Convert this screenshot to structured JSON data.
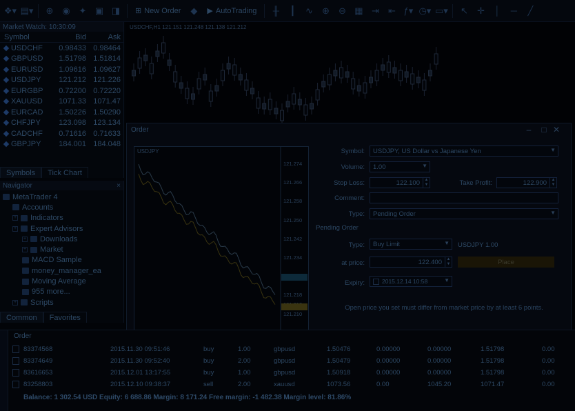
{
  "toolbar": {
    "new_order_label": "New Order",
    "autotrading_label": "AutoTrading"
  },
  "market_watch": {
    "title": "Market Watch: 10:30:09",
    "col_symbol": "Symbol",
    "col_bid": "Bid",
    "col_ask": "Ask",
    "rows": [
      {
        "symbol": "USDCHF",
        "bid": "0.98433",
        "ask": "0.98464"
      },
      {
        "symbol": "GBPUSD",
        "bid": "1.51798",
        "ask": "1.51814"
      },
      {
        "symbol": "EURUSD",
        "bid": "1.09616",
        "ask": "1.09627"
      },
      {
        "symbol": "USDJPY",
        "bid": "121.212",
        "ask": "121.226"
      },
      {
        "symbol": "EURGBP",
        "bid": "0.72200",
        "ask": "0.72220"
      },
      {
        "symbol": "XAUUSD",
        "bid": "1071.33",
        "ask": "1071.47"
      },
      {
        "symbol": "EURCAD",
        "bid": "1.50226",
        "ask": "1.50290"
      },
      {
        "symbol": "CHFJPY",
        "bid": "123.098",
        "ask": "123.134"
      },
      {
        "symbol": "CADCHF",
        "bid": "0.71616",
        "ask": "0.71633"
      },
      {
        "symbol": "GBPJPY",
        "bid": "184.001",
        "ask": "184.048"
      }
    ],
    "tabs": [
      "Symbols",
      "Tick Chart"
    ]
  },
  "navigator": {
    "title": "Navigator",
    "items": [
      {
        "label": "MetaTrader 4",
        "level": 0
      },
      {
        "label": "Accounts",
        "level": 1
      },
      {
        "label": "Indicators",
        "level": 1
      },
      {
        "label": "Expert Advisors",
        "level": 1
      },
      {
        "label": "Downloads",
        "level": 2
      },
      {
        "label": "Market",
        "level": 2
      },
      {
        "label": "MACD Sample",
        "level": 2
      },
      {
        "label": "money_manager_ea",
        "level": 2
      },
      {
        "label": "Moving Average",
        "level": 2
      },
      {
        "label": "955 more...",
        "level": 2
      },
      {
        "label": "Scripts",
        "level": 1
      }
    ],
    "tabs": [
      "Common",
      "Favorites"
    ]
  },
  "chart": {
    "header": "USDCHF,H1  121.151 121.248 121.138 121.212"
  },
  "order_dialog": {
    "title": "Order",
    "mini_chart_symbol": "USDJPY",
    "mini_chart_ticks": [
      "121.274",
      "121.266",
      "121.258",
      "121.250",
      "121.242",
      "121.234",
      "121.226",
      "121.218",
      "121.212",
      "121.210",
      "121.202"
    ],
    "symbol_label": "Symbol:",
    "symbol_value": "USDJPY, US Dollar vs Japanese Yen",
    "volume_label": "Volume:",
    "volume_value": "1.00",
    "stop_loss_label": "Stop Loss:",
    "stop_loss_value": "122.100",
    "take_profit_label": "Take Profit:",
    "take_profit_value": "122.900",
    "comment_label": "Comment:",
    "comment_value": "",
    "type_label": "Type:",
    "type_value": "Pending Order",
    "pending_section": "Pending Order",
    "pending_type_label": "Type:",
    "pending_type_value": "Buy Limit",
    "pending_info": "USDJPY 1.00",
    "price_label": "at price:",
    "price_value": "122.400",
    "place_label": "Place",
    "expiry_label": "Expiry:",
    "expiry_value": "2015.12.14 10:58",
    "notice": "Open price you set must differ from market price by at least 6 points."
  },
  "terminal": {
    "header": "Order",
    "rows": [
      {
        "order": "83374568",
        "time": "2015.11.30 09:51:46",
        "type": "buy",
        "size": "1.00",
        "symbol": "gbpusd",
        "price": "1.50476",
        "sl": "0.00000",
        "tp": "0.00000",
        "cur": "1.51798",
        "profit": "0.00"
      },
      {
        "order": "83374649",
        "time": "2015.11.30 09:52:40",
        "type": "buy",
        "size": "2.00",
        "symbol": "gbpusd",
        "price": "1.50479",
        "sl": "0.00000",
        "tp": "0.00000",
        "cur": "1.51798",
        "profit": "0.00"
      },
      {
        "order": "83616653",
        "time": "2015.12.01 13:17:55",
        "type": "buy",
        "size": "1.00",
        "symbol": "gbpusd",
        "price": "1.50918",
        "sl": "0.00000",
        "tp": "0.00000",
        "cur": "1.51798",
        "profit": "0.00"
      },
      {
        "order": "83258803",
        "time": "2015.12.10 09:38:37",
        "type": "sell",
        "size": "2.00",
        "symbol": "xauusd",
        "price": "1073.56",
        "sl": "0.00",
        "tp": "1045.20",
        "cur": "1071.47",
        "profit": "0.00"
      }
    ],
    "balance": "Balance: 1 302.54 USD   Equity: 6 688.86   Margin: 8 171.24   Free margin: -1 482.38   Margin level: 81.86%"
  }
}
